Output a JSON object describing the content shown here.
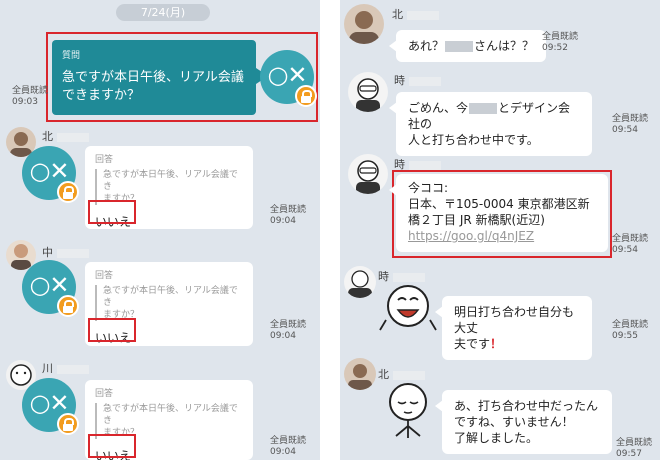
{
  "left": {
    "date": "7/24(月)",
    "question": {
      "label": "質問",
      "text_line1": "急ですが本日午後、リアル会議",
      "text_line2": "できますか？",
      "read_status": "全員既読",
      "time": "09:03"
    },
    "app_icon_glyph": "○✕",
    "answers": [
      {
        "sender": "北",
        "label": "回答",
        "quote_line1": "急ですが本日午後、リアル会議でき",
        "quote_line2": "ますか？",
        "answer": "いいえ",
        "read_status": "全員既読",
        "time": "09:04"
      },
      {
        "sender": "中",
        "label": "回答",
        "quote_line1": "急ですが本日午後、リアル会議でき",
        "quote_line2": "ますか？",
        "answer": "いいえ",
        "read_status": "全員既読",
        "time": "09:04"
      },
      {
        "sender": "川",
        "label": "回答",
        "quote_line1": "急ですが本日午後、リアル会議でき",
        "quote_line2": "ますか？",
        "answer": "いいえ",
        "read_status": "全員既読",
        "time": "09:04"
      }
    ]
  },
  "right": {
    "messages": [
      {
        "sender": "北",
        "text_before": "あれ？",
        "text_after": "さんは？？",
        "read_status": "全員既読",
        "time": "09:52"
      },
      {
        "sender": "時",
        "line1_before": "ごめん、今",
        "line1_after": "とデザイン会社の",
        "line2": "人と打ち合わせ中です。",
        "read_status": "全員既読",
        "time": "09:54"
      },
      {
        "sender": "時",
        "line1": "今ココ:",
        "line2": "日本、〒105-0004 東京都港区新",
        "line3": "橋２丁目 JR 新橋駅(近辺)",
        "link": "https://goo.gl/q4nJEZ",
        "read_status": "全員既読",
        "time": "09:54"
      },
      {
        "sender": "時",
        "line1": "明日打ち合わせ自分も大丈",
        "line2": "夫です",
        "exclaim": "！",
        "read_status": "全員既読",
        "time": "09:55"
      },
      {
        "sender": "北",
        "line1": "あ、打ち合わせ中だったん",
        "line2": "ですね、すいません！",
        "line3": "了解しました。",
        "read_status": "全員既読",
        "time": "09:57"
      }
    ]
  },
  "colors": {
    "chat_bg": "#dfe5ec",
    "question_bubble": "#1f8a97",
    "app_icon": "#3aa5b3",
    "lock_badge": "#f29c1f",
    "highlight_box": "#d9262c"
  }
}
